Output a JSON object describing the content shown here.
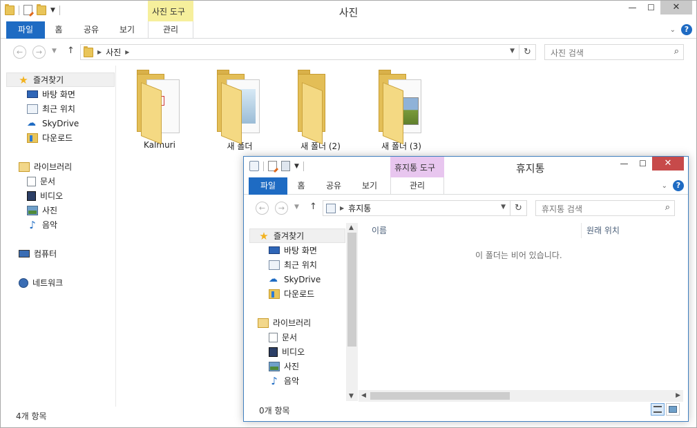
{
  "photos_window": {
    "title": "사진",
    "context_tab": "사진 도구",
    "ribbon": {
      "file": "파일",
      "home": "홈",
      "share": "공유",
      "view": "보기",
      "manage": "관리"
    },
    "address": {
      "crumb": "사진",
      "search_placeholder": "사진 검색"
    },
    "nav": {
      "favorites": "즐겨찾기",
      "desktop": "바탕 화면",
      "recent": "최근 위치",
      "skydrive": "SkyDrive",
      "downloads": "다운로드",
      "libraries": "라이브러리",
      "documents": "문서",
      "videos": "비디오",
      "pictures": "사진",
      "music": "음악",
      "computer": "컴퓨터",
      "network": "네트워크"
    },
    "items": [
      {
        "label": "Kalmuri"
      },
      {
        "label": "새 폴더"
      },
      {
        "label": "새 폴더 (2)"
      },
      {
        "label": "새 폴더 (3)"
      }
    ],
    "status": "4개 항목"
  },
  "recycle_window": {
    "title": "휴지통",
    "context_tab": "휴지통 도구",
    "ribbon": {
      "file": "파일",
      "home": "홈",
      "share": "공유",
      "view": "보기",
      "manage": "관리"
    },
    "address": {
      "crumb": "휴지통",
      "search_placeholder": "휴지통 검색"
    },
    "nav": {
      "favorites": "즐겨찾기",
      "desktop": "바탕 화면",
      "recent": "최근 위치",
      "skydrive": "SkyDrive",
      "downloads": "다운로드",
      "libraries": "라이브러리",
      "documents": "문서",
      "videos": "비디오",
      "pictures": "사진",
      "music": "음악"
    },
    "columns": {
      "name": "이름",
      "original_location": "원래 위치"
    },
    "empty_message": "이 폴더는 비어 있습니다.",
    "status": "0개 항목"
  },
  "window_controls": {
    "minimize": "—",
    "maximize": "☐",
    "close": "✕"
  },
  "colors": {
    "file_tab": "#1e6bc3",
    "photo_tools": "#f6ef9c",
    "recycle_tools": "#e8c6ef",
    "close_active": "#c74a4a"
  }
}
